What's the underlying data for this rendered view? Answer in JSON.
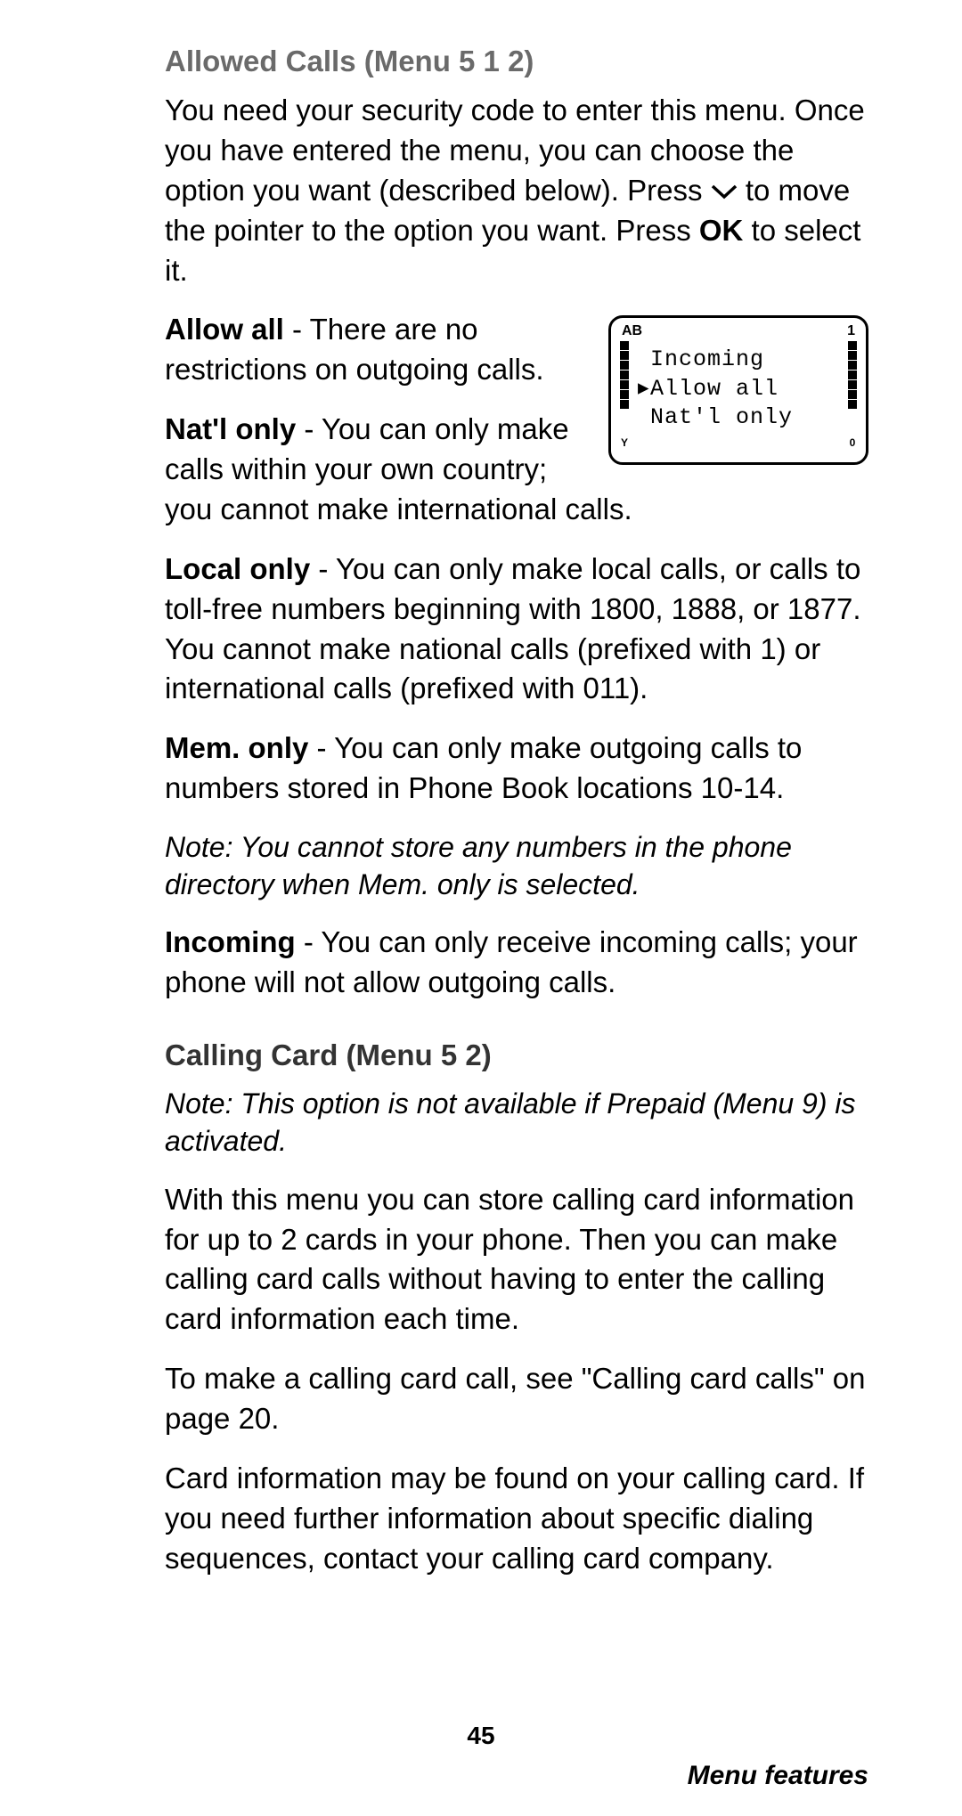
{
  "section1": {
    "heading": "Allowed Calls (Menu 5 1 2)",
    "intro_a": "You need your security code to enter this menu. Once you have entered the menu, you can choose the option you want (described below). Press ",
    "intro_b": " to move the pointer to the option you want. Press ",
    "intro_ok": "OK",
    "intro_c": " to select it.",
    "allow_all_label": "Allow all",
    "allow_all_text": " - There are no restrictions on outgoing calls.",
    "natl_label": "Nat'l only",
    "natl_text": " - You can only make calls within your own country; you cannot make international calls.",
    "local_label": "Local only",
    "local_text": " - You can only make local calls, or calls to toll-free numbers beginning with 1800, 1888, or 1877. You cannot make national calls (prefixed with 1) or international calls (prefixed with 011).",
    "mem_label": "Mem. only",
    "mem_text": " - You can only make outgoing calls to numbers stored in Phone Book locations 10-14.",
    "note1": "Note: You cannot store any numbers in the phone directory when Mem. only is selected.",
    "incoming_label": "Incoming",
    "incoming_text": " - You can only receive incoming calls; your phone will not allow outgoing calls."
  },
  "lcd": {
    "topbar_left": "AB",
    "topbar_right": "1",
    "sig_letter": "Y",
    "bat_letter": "0",
    "line1": "Incoming",
    "line2": "Allow all",
    "line3": "Nat'l only"
  },
  "section2": {
    "heading": "Calling Card (Menu 5 2)",
    "note": "Note: This option is not available if  Prepaid (Menu 9) is activated.",
    "p1": "With this menu you can store calling card information for up to 2 cards in your phone. Then you can make calling card calls without having to enter the calling card information each time.",
    "p2": "To make a calling card call, see \"Calling card calls\" on page 20.",
    "p3": "Card information may be found on your calling card. If you need further information about specific dialing sequences, contact your calling card company."
  },
  "footer": {
    "page": "45",
    "section": "Menu features"
  }
}
